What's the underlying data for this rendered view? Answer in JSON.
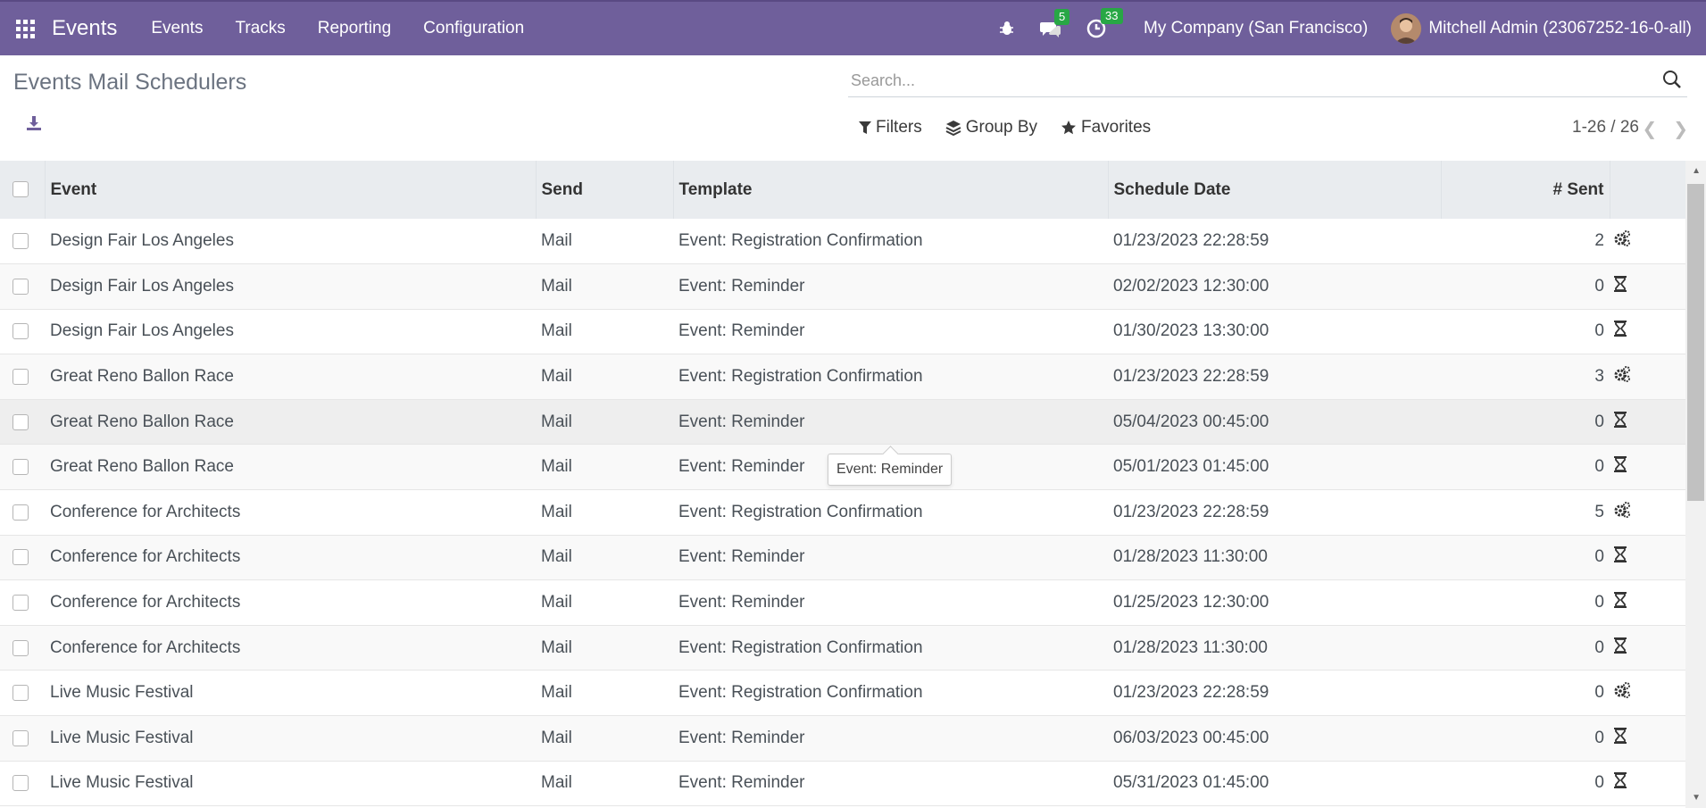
{
  "navbar": {
    "brand": "Events",
    "menu": [
      "Events",
      "Tracks",
      "Reporting",
      "Configuration"
    ],
    "chat_badge": "5",
    "activity_badge": "33",
    "company": "My Company (San Francisco)",
    "user": "Mitchell Admin (23067252-16-0-all)"
  },
  "page": {
    "title": "Events Mail Schedulers"
  },
  "search": {
    "placeholder": "Search..."
  },
  "filters": {
    "filters_label": "Filters",
    "groupby_label": "Group By",
    "favorites_label": "Favorites"
  },
  "pager": {
    "value": "1-26 / 26"
  },
  "table": {
    "headers": {
      "event": "Event",
      "send": "Send",
      "template": "Template",
      "schedule_date": "Schedule Date",
      "sent": "# Sent"
    },
    "rows": [
      {
        "event": "Design Fair Los Angeles",
        "send": "Mail",
        "template": "Event: Registration Confirmation",
        "date": "01/23/2023 22:28:59",
        "sent": "2",
        "status": "gears-icon"
      },
      {
        "event": "Design Fair Los Angeles",
        "send": "Mail",
        "template": "Event: Reminder",
        "date": "02/02/2023 12:30:00",
        "sent": "0",
        "status": "hourglass-icon"
      },
      {
        "event": "Design Fair Los Angeles",
        "send": "Mail",
        "template": "Event: Reminder",
        "date": "01/30/2023 13:30:00",
        "sent": "0",
        "status": "hourglass-icon"
      },
      {
        "event": "Great Reno Ballon Race",
        "send": "Mail",
        "template": "Event: Registration Confirmation",
        "date": "01/23/2023 22:28:59",
        "sent": "3",
        "status": "gears-icon"
      },
      {
        "event": "Great Reno Ballon Race",
        "send": "Mail",
        "template": "Event: Reminder",
        "date": "05/04/2023 00:45:00",
        "sent": "0",
        "status": "hourglass-icon"
      },
      {
        "event": "Great Reno Ballon Race",
        "send": "Mail",
        "template": "Event: Reminder",
        "date": "05/01/2023 01:45:00",
        "sent": "0",
        "status": "hourglass-icon"
      },
      {
        "event": "Conference for Architects",
        "send": "Mail",
        "template": "Event: Registration Confirmation",
        "date": "01/23/2023 22:28:59",
        "sent": "5",
        "status": "gears-icon"
      },
      {
        "event": "Conference for Architects",
        "send": "Mail",
        "template": "Event: Reminder",
        "date": "01/28/2023 11:30:00",
        "sent": "0",
        "status": "hourglass-icon"
      },
      {
        "event": "Conference for Architects",
        "send": "Mail",
        "template": "Event: Reminder",
        "date": "01/25/2023 12:30:00",
        "sent": "0",
        "status": "hourglass-icon"
      },
      {
        "event": "Conference for Architects",
        "send": "Mail",
        "template": "Event: Registration Confirmation",
        "date": "01/28/2023 11:30:00",
        "sent": "0",
        "status": "hourglass-icon"
      },
      {
        "event": "Live Music Festival",
        "send": "Mail",
        "template": "Event: Registration Confirmation",
        "date": "01/23/2023 22:28:59",
        "sent": "0",
        "status": "gears-icon"
      },
      {
        "event": "Live Music Festival",
        "send": "Mail",
        "template": "Event: Reminder",
        "date": "06/03/2023 00:45:00",
        "sent": "0",
        "status": "hourglass-icon"
      },
      {
        "event": "Live Music Festival",
        "send": "Mail",
        "template": "Event: Reminder",
        "date": "05/31/2023 01:45:00",
        "sent": "0",
        "status": "hourglass-icon"
      }
    ]
  },
  "tooltip": {
    "text": "Event: Reminder"
  },
  "colors": {
    "navbar": "#6f5f9b",
    "badge": "#28a745",
    "header_bg": "#e9ecef"
  }
}
